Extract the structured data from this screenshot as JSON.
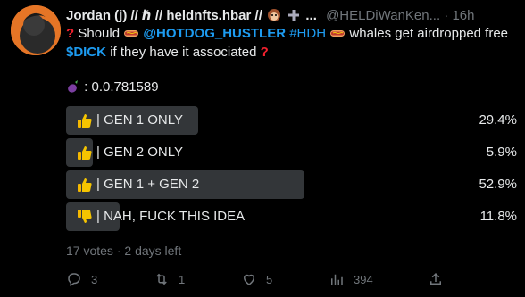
{
  "author": {
    "display_name": "Jordan (j) // ℏ // heldnfts.hbar //",
    "handle": "@HELDiWanKen...",
    "separator": "·",
    "time": "16h"
  },
  "tweet": {
    "line1_prefix": "Should",
    "mention": "@HOTDOG_HUSTLER",
    "hashtag": "#HDH",
    "line1_suffix": "whales get airdropped free",
    "cashtag": "$DICK",
    "line2_suffix": "if they have it associated",
    "value_label": ": 0.0.781589"
  },
  "poll": {
    "options": [
      {
        "label": "| GEN 1 ONLY",
        "percent": "29.4%",
        "share": 0.294,
        "icon": "thumbs-up-icon"
      },
      {
        "label": "| GEN 2 ONLY",
        "percent": "5.9%",
        "share": 0.059,
        "icon": "thumbs-up-icon"
      },
      {
        "label": "| GEN 1 + GEN 2",
        "percent": "52.9%",
        "share": 0.529,
        "icon": "thumbs-up-icon"
      },
      {
        "label": "| NAH, FUCK THIS IDEA",
        "percent": "11.8%",
        "share": 0.118,
        "icon": "thumbs-down-icon"
      }
    ],
    "votes": "17 votes",
    "separator": "·",
    "time_left": "2 days left"
  },
  "actions": {
    "reply_count": "3",
    "retweet_count": "1",
    "like_count": "5",
    "view_count": "394"
  },
  "colors": {
    "accent": "#1d9bf0",
    "alert": "#f4212e",
    "bar": "#333639",
    "muted": "#71767b"
  }
}
